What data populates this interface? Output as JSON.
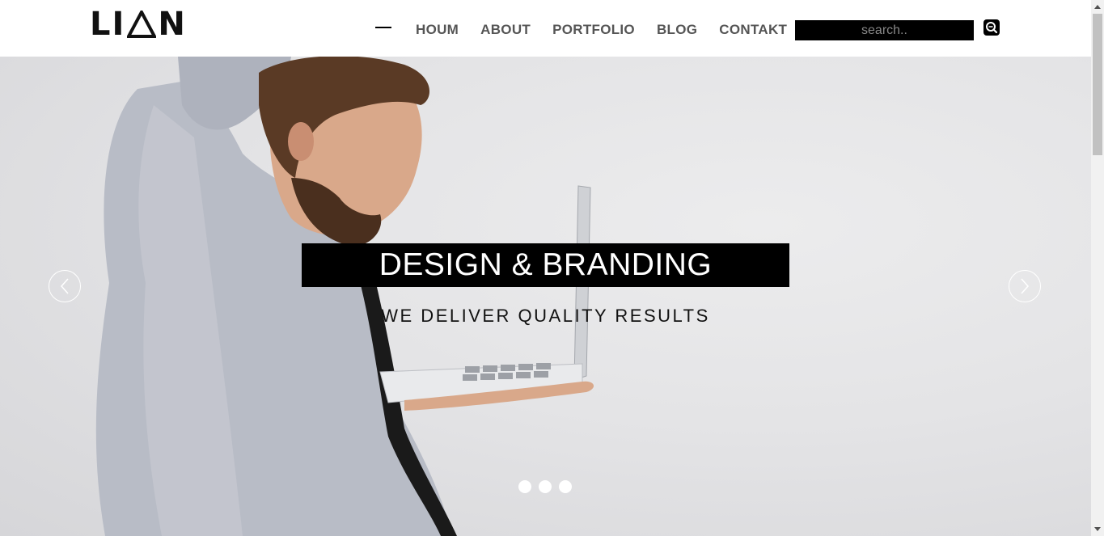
{
  "brand": {
    "logo_text_left": "LI",
    "logo_text_right": "N"
  },
  "nav": {
    "items": [
      {
        "label": "HOUM"
      },
      {
        "label": "ABOUT"
      },
      {
        "label": "PORTFOLIO"
      },
      {
        "label": "BLOG"
      },
      {
        "label": "CONTAKT"
      }
    ]
  },
  "search": {
    "placeholder": "search.."
  },
  "hero": {
    "headline": "DESIGN & BRANDING",
    "subline": "WE DELIVER QUALITY RESULTS",
    "slide_count": 3
  },
  "colors": {
    "accent": "#000000",
    "nav_text": "#555555",
    "hero_bg": "#e4e4e6"
  }
}
